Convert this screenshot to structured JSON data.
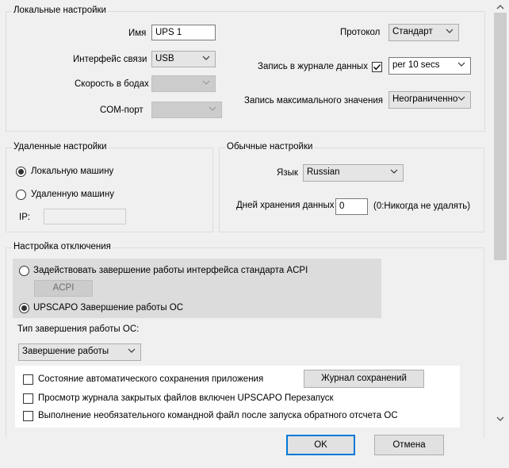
{
  "local": {
    "title": "Локальные настройки",
    "name_label": "Имя",
    "name_value": "UPS 1",
    "interface_label": "Интерфейс связи",
    "interface_value": "USB",
    "baud_label": "Скорость в бодах",
    "baud_value": "",
    "com_label": "COM-порт",
    "com_value": "",
    "protocol_label": "Протокол",
    "protocol_value": "Стандарт",
    "log_label": "Запись в журнале данных",
    "log_checked": true,
    "log_interval": "per 10 secs",
    "max_label": "Запись максимального значения",
    "max_value": "Неограниченно"
  },
  "remote": {
    "title": "Удаленные настройки",
    "local_machine": "Локальную машину",
    "remote_machine": "Удаленную машину",
    "ip_label": "IP:",
    "ip_value": ""
  },
  "general": {
    "title": "Обычные настройки",
    "lang_label": "Язык",
    "lang_value": "Russian",
    "days_label": "Дней хранения данных",
    "days_value": "0",
    "days_note": "(0:Никогда не удалять)"
  },
  "shutdown": {
    "title": "Настройка отключения",
    "acpi_option": "Задействовать завершение работы интерфейса стандарта ACPI",
    "acpi_button": "ACPI",
    "os_option": "UPSCAPO Завершение работы ОС",
    "type_label": "Тип завершения работы ОС:",
    "type_value": "Завершение работы",
    "opt1": "Состояние автоматического сохранения приложения",
    "opt2": "Просмотр журнала закрытых файлов включен UPSCAPO Перезапуск",
    "opt3": "Выполнение необязательного командной файл после запуска обратного отсчета ОС",
    "journal_button": "Журнал сохранений"
  },
  "footer": {
    "ok": "OK",
    "cancel": "Отмена"
  },
  "icons": {
    "chevron": "chevron-down-icon",
    "scroll_up": "scroll-up-arrow-icon",
    "scroll_down": "scroll-down-arrow-icon"
  }
}
